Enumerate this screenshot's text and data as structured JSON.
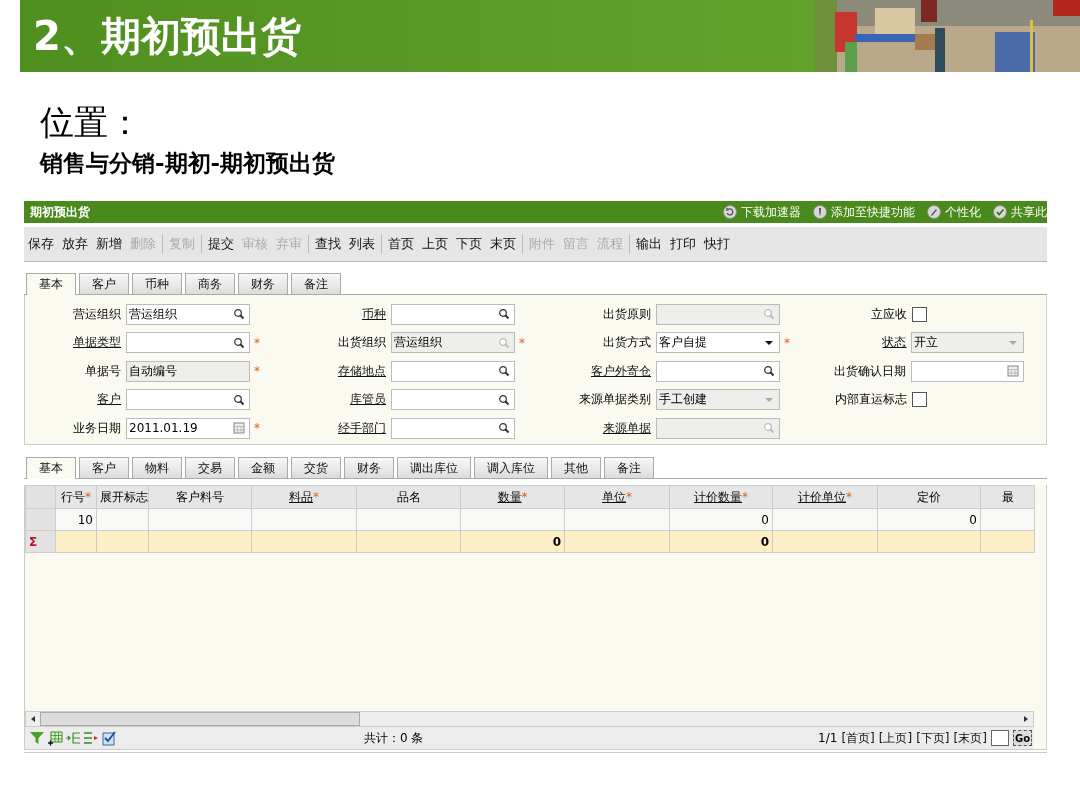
{
  "slide": {
    "title": "2、期初预出货",
    "heading": "位置：",
    "path": "销售与分销-期初-期初预出货"
  },
  "app": {
    "title": "期初预出货",
    "header_links": [
      {
        "kind": "refresh",
        "label": "下载加速器"
      },
      {
        "kind": "pin",
        "label": "添加至快捷功能"
      },
      {
        "kind": "pencil",
        "label": "个性化"
      },
      {
        "kind": "check",
        "label": "共享此"
      }
    ],
    "toolbar": [
      [
        {
          "label": "保存",
          "disabled": false
        },
        {
          "label": "放弃",
          "disabled": false
        },
        {
          "label": "新增",
          "disabled": false
        },
        {
          "label": "删除",
          "disabled": true
        }
      ],
      [
        {
          "label": "复制",
          "disabled": true
        }
      ],
      [
        {
          "label": "提交",
          "disabled": false
        },
        {
          "label": "审核",
          "disabled": true
        },
        {
          "label": "弃审",
          "disabled": true
        }
      ],
      [
        {
          "label": "查找",
          "disabled": false
        },
        {
          "label": "列表",
          "disabled": false
        }
      ],
      [
        {
          "label": "首页",
          "disabled": false
        },
        {
          "label": "上页",
          "disabled": false
        },
        {
          "label": "下页",
          "disabled": false
        },
        {
          "label": "末页",
          "disabled": false
        }
      ],
      [
        {
          "label": "附件",
          "disabled": true
        },
        {
          "label": "留言",
          "disabled": true
        },
        {
          "label": "流程",
          "disabled": true
        }
      ],
      [
        {
          "label": "输出",
          "disabled": false
        },
        {
          "label": "打印",
          "disabled": false
        },
        {
          "label": "快打",
          "disabled": false
        }
      ]
    ],
    "header_tabs": [
      {
        "label": "基本",
        "selected": true
      },
      {
        "label": "客户",
        "selected": false
      },
      {
        "label": "币种",
        "selected": false
      },
      {
        "label": "商务",
        "selected": false
      },
      {
        "label": "财务",
        "selected": false
      },
      {
        "label": "备注",
        "selected": false
      }
    ],
    "form_columns": [
      [
        {
          "label": "营运组织",
          "link": false,
          "kind": "lookup",
          "value": "营运组织",
          "disabled": false
        },
        {
          "label": "单据类型",
          "link": true,
          "kind": "lookup",
          "disabled": false,
          "required_mark": "*"
        },
        {
          "label": "单据号",
          "link": false,
          "kind": "text",
          "value": "自动编号",
          "disabled": true,
          "required_mark": "*"
        },
        {
          "label": "客户",
          "link": true,
          "kind": "lookup",
          "disabled": false
        },
        {
          "label": "业务日期",
          "link": false,
          "kind": "date",
          "value": "2011.01.19",
          "disabled": false,
          "required_mark": "*"
        }
      ],
      [
        {
          "label": "币种",
          "link": true,
          "kind": "lookup",
          "disabled": false
        },
        {
          "label": "出货组织",
          "link": false,
          "kind": "lookup",
          "value": "营运组织",
          "disabled": true,
          "required_mark": "*"
        },
        {
          "label": "存储地点",
          "link": true,
          "kind": "lookup",
          "disabled": false
        },
        {
          "label": "库管员",
          "link": true,
          "kind": "lookup",
          "disabled": false
        },
        {
          "label": "经手部门",
          "link": true,
          "kind": "lookup",
          "disabled": false
        }
      ],
      [
        {
          "label": "出货原则",
          "link": false,
          "kind": "lookup",
          "disabled": true
        },
        {
          "label": "出货方式",
          "link": false,
          "kind": "dropdown",
          "value": "客户自提",
          "disabled": false,
          "required_mark": "*"
        },
        {
          "label": "客户外寄仓",
          "link": true,
          "kind": "lookup",
          "disabled": false
        },
        {
          "label": "来源单据类别",
          "link": false,
          "kind": "dropdown",
          "value": "手工创建",
          "disabled": true
        },
        {
          "label": "来源单据",
          "link": true,
          "kind": "lookup",
          "disabled": true
        }
      ],
      [
        {
          "label": "立应收",
          "link": false,
          "kind": "checkbox",
          "checked": false
        },
        {
          "label": "状态",
          "link": true,
          "kind": "dropdown",
          "value": "开立",
          "disabled": true
        },
        {
          "label": "出货确认日期",
          "link": false,
          "kind": "date",
          "disabled": false
        },
        {
          "label": "内部直运标志",
          "link": false,
          "kind": "checkbox",
          "checked": false
        }
      ]
    ],
    "detail_tabs": [
      {
        "label": "基本",
        "selected": true
      },
      {
        "label": "客户",
        "selected": false
      },
      {
        "label": "物料",
        "selected": false
      },
      {
        "label": "交易",
        "selected": false
      },
      {
        "label": "金额",
        "selected": false
      },
      {
        "label": "交货",
        "selected": false
      },
      {
        "label": "财务",
        "selected": false
      },
      {
        "label": "调出库位",
        "selected": false
      },
      {
        "label": "调入库位",
        "selected": false
      },
      {
        "label": "其他",
        "selected": false
      },
      {
        "label": "备注",
        "selected": false
      }
    ],
    "grid": {
      "columns": [
        {
          "label": "行号",
          "link": false,
          "required_mark": "*"
        },
        {
          "label": "展开标志",
          "link": false
        },
        {
          "label": "客户料号",
          "link": false
        },
        {
          "label": "料品",
          "link": true,
          "required_mark": "*"
        },
        {
          "label": "品名",
          "link": false
        },
        {
          "label": "数量",
          "link": true,
          "required_mark": "*"
        },
        {
          "label": "单位",
          "link": true,
          "required_mark": "*"
        },
        {
          "label": "计价数量",
          "link": true,
          "required_mark": "*"
        },
        {
          "label": "计价单位",
          "link": true,
          "required_mark": "*"
        },
        {
          "label": "定价",
          "link": false
        },
        {
          "label": "最",
          "link": false
        }
      ],
      "rows": [
        [
          "10",
          "",
          "",
          "",
          "",
          "",
          "",
          "0",
          "",
          "0",
          ""
        ]
      ],
      "sum_row": {
        "marker": "Σ",
        "cells": [
          "",
          "",
          "",
          "",
          "",
          "0",
          "",
          "0",
          "",
          "",
          ""
        ]
      }
    },
    "footer": {
      "total": "共计：0 条",
      "page": "1/1",
      "pager": [
        "[首页]",
        "[上页]",
        "[下页]",
        "[末页]"
      ],
      "go": "Go"
    }
  }
}
